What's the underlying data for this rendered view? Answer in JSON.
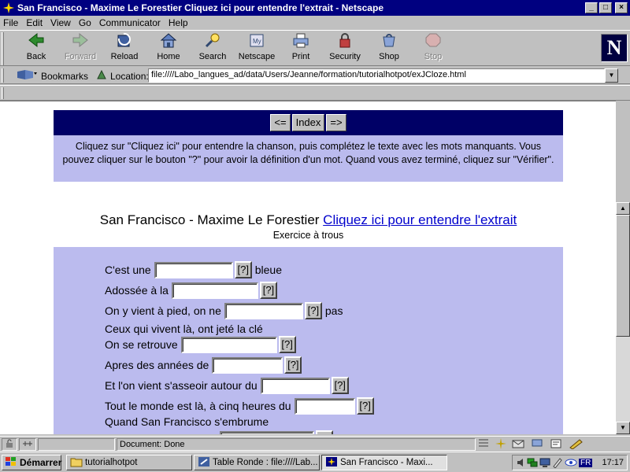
{
  "window": {
    "title": "San Francisco - Maxime Le Forestier Cliquez ici pour entendre l'extrait - Netscape",
    "controls": {
      "minimize": "_",
      "maximize": "□",
      "close": "×"
    }
  },
  "menu": [
    "File",
    "Edit",
    "View",
    "Go",
    "Communicator",
    "Help"
  ],
  "toolbar": {
    "buttons": [
      {
        "label": "Back",
        "icon": "back-arrow-icon",
        "enabled": true
      },
      {
        "label": "Forward",
        "icon": "forward-arrow-icon",
        "enabled": false
      },
      {
        "label": "Reload",
        "icon": "reload-icon",
        "enabled": true
      },
      {
        "label": "Home",
        "icon": "home-icon",
        "enabled": true
      },
      {
        "label": "Search",
        "icon": "search-icon",
        "enabled": true
      },
      {
        "label": "Netscape",
        "icon": "netscape-icon",
        "enabled": true
      },
      {
        "label": "Print",
        "icon": "print-icon",
        "enabled": true
      },
      {
        "label": "Security",
        "icon": "lock-icon",
        "enabled": true
      },
      {
        "label": "Shop",
        "icon": "shop-icon",
        "enabled": true
      },
      {
        "label": "Stop",
        "icon": "stop-icon",
        "enabled": false
      }
    ],
    "logo": "N"
  },
  "location": {
    "bookmarks_label": "Bookmarks",
    "location_label": "Location:",
    "url": "file:////Labo_langues_ad/data/Users/Jeanne/formation/tutorialhotpot/exJCloze.html"
  },
  "page": {
    "nav": {
      "prev": "<=",
      "index": "Index",
      "next": "=>"
    },
    "instructions": "Cliquez sur \"Cliquez ici\" pour entendre la chanson, puis complétez le texte avec les mots manquants. Vous pouvez cliquer sur le bouton \"?\" pour avoir la définition d'un mot. Quand vous avez terminé, cliquez sur \"Vérifier\".",
    "title": "San Francisco - Maxime Le Forestier",
    "title_link": "Cliquez ici pour entendre l'extrait",
    "subtitle": "Exercice à trous",
    "hint_label": "[?]",
    "lines": [
      {
        "before": "C'est une",
        "after": "bleue"
      },
      {
        "before": "Adossée à la",
        "after": ""
      },
      {
        "before": "On y vient à pied, on ne",
        "after": "pas"
      },
      {
        "text": "Ceux qui vivent là, ont jeté la clé"
      },
      {
        "before": "On se retrouve",
        "after": ""
      },
      {
        "before": "Apres des années de",
        "after": ""
      },
      {
        "before": "Et l'on vient s'asseoir autour du",
        "after": ""
      },
      {
        "before": "Tout le monde est là, à cinq heures du",
        "after": ""
      },
      {
        "text": "Quand San Francisco s'embrume"
      }
    ]
  },
  "status": {
    "text": "Document: Done"
  },
  "taskbar": {
    "start_label": "Démarrer",
    "tasks": [
      {
        "label": "tutorialhotpot",
        "icon": "folder-icon"
      },
      {
        "label": "Table Ronde : file:////Lab...",
        "icon": "editor-icon"
      },
      {
        "label": "San Francisco - Maxi...",
        "icon": "netscape-icon"
      }
    ],
    "lang": "FR",
    "clock": "17:17"
  }
}
